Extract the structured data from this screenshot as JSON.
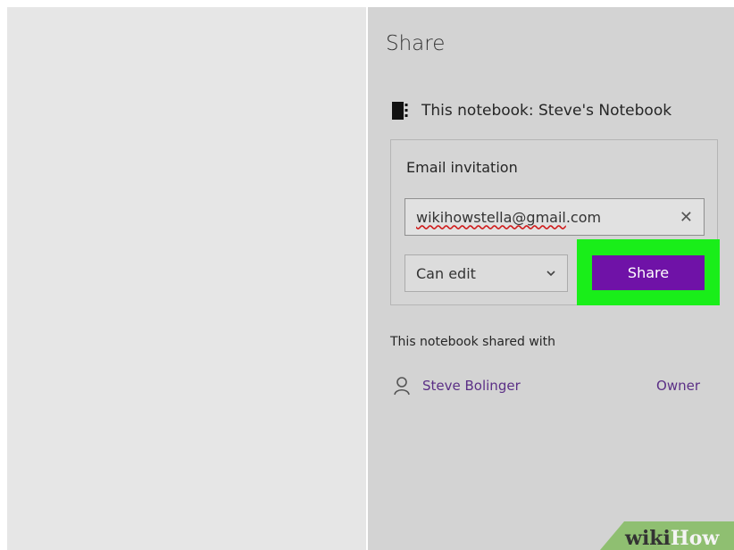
{
  "panel": {
    "title": "Share",
    "notebook_label": "This notebook: Steve's Notebook",
    "notebook_icon": "notebook-icon"
  },
  "invite": {
    "heading": "Email invitation",
    "email_misspelled_part": "wikihowstella@gmail",
    "email_rest": ".com",
    "clear_icon": "close-icon",
    "permission": "Can edit",
    "share_label": "Share"
  },
  "shared_with": {
    "heading": "This notebook shared with",
    "members": [
      {
        "name": "Steve Bolinger",
        "role": "Owner",
        "icon": "person-icon"
      }
    ]
  },
  "watermark": {
    "part1": "wiki",
    "part2": "How"
  },
  "colors": {
    "accent": "#6f12a7",
    "highlight": "#19ee19",
    "link": "#5b2f86"
  }
}
